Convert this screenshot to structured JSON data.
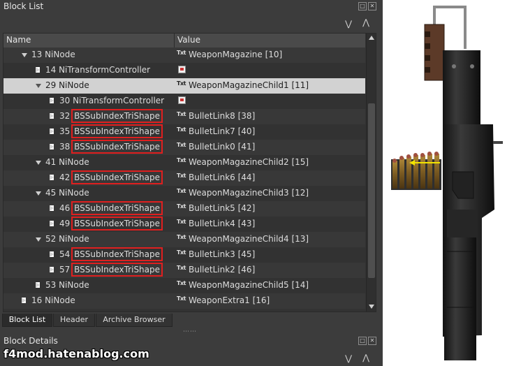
{
  "block_list": {
    "title": "Block List",
    "title_buttons": [
      "restore-icon",
      "close-icon"
    ],
    "columns": {
      "name": "Name",
      "value": "Value"
    },
    "rows": [
      {
        "indent": 1,
        "expander": "down",
        "name": "13 NiNode",
        "value_icon": "Txt",
        "value": "WeaponMagazine [10]",
        "highlight": false,
        "selected": false
      },
      {
        "indent": 2,
        "expander": "right",
        "name": "14 NiTransformController",
        "value_icon": "flag",
        "value": "",
        "highlight": false,
        "selected": false
      },
      {
        "indent": 2,
        "expander": "down",
        "name": "29 NiNode",
        "value_icon": "Txt",
        "value": "WeaponMagazineChild1 [11]",
        "highlight": false,
        "selected": true
      },
      {
        "indent": 3,
        "expander": "right",
        "name": "30 NiTransformController",
        "value_icon": "flag",
        "value": "",
        "highlight": false,
        "selected": false
      },
      {
        "indent": 3,
        "expander": "right",
        "idx": "32",
        "label": "BSSubIndexTriShape",
        "value_icon": "Txt",
        "value": "BulletLink8 [38]",
        "highlight": true,
        "selected": false
      },
      {
        "indent": 3,
        "expander": "right",
        "idx": "35",
        "label": "BSSubIndexTriShape",
        "value_icon": "Txt",
        "value": "BulletLink7 [40]",
        "highlight": true,
        "selected": false
      },
      {
        "indent": 3,
        "expander": "right",
        "idx": "38",
        "label": "BSSubIndexTriShape",
        "value_icon": "Txt",
        "value": "BulletLink0 [41]",
        "highlight": true,
        "selected": false
      },
      {
        "indent": 2,
        "expander": "down",
        "name": "41 NiNode",
        "value_icon": "Txt",
        "value": "WeaponMagazineChild2 [15]",
        "highlight": false,
        "selected": false
      },
      {
        "indent": 3,
        "expander": "right",
        "idx": "42",
        "label": "BSSubIndexTriShape",
        "value_icon": "Txt",
        "value": "BulletLink6 [44]",
        "highlight": true,
        "selected": false
      },
      {
        "indent": 2,
        "expander": "down",
        "name": "45 NiNode",
        "value_icon": "Txt",
        "value": "WeaponMagazineChild3 [12]",
        "highlight": false,
        "selected": false
      },
      {
        "indent": 3,
        "expander": "right",
        "idx": "46",
        "label": "BSSubIndexTriShape",
        "value_icon": "Txt",
        "value": "BulletLink5 [42]",
        "highlight": true,
        "selected": false
      },
      {
        "indent": 3,
        "expander": "right",
        "idx": "49",
        "label": "BSSubIndexTriShape",
        "value_icon": "Txt",
        "value": "BulletLink4 [43]",
        "highlight": true,
        "selected": false
      },
      {
        "indent": 2,
        "expander": "down",
        "name": "52 NiNode",
        "value_icon": "Txt",
        "value": "WeaponMagazineChild4 [13]",
        "highlight": false,
        "selected": false
      },
      {
        "indent": 3,
        "expander": "right",
        "idx": "54",
        "label": "BSSubIndexTriShape",
        "value_icon": "Txt",
        "value": "BulletLink3 [45]",
        "highlight": true,
        "selected": false
      },
      {
        "indent": 3,
        "expander": "right",
        "idx": "57",
        "label": "BSSubIndexTriShape",
        "value_icon": "Txt",
        "value": "BulletLink2 [46]",
        "highlight": true,
        "selected": false
      },
      {
        "indent": 2,
        "expander": "right",
        "name": "53 NiNode",
        "value_icon": "Txt",
        "value": "WeaponMagazineChild5 [14]",
        "highlight": false,
        "selected": false
      },
      {
        "indent": 1,
        "expander": "right",
        "name": "16 NiNode",
        "value_icon": "Txt",
        "value": "WeaponExtra1 [16]",
        "highlight": false,
        "selected": false
      }
    ]
  },
  "tabs": [
    {
      "label": "Block List",
      "active": true
    },
    {
      "label": "Header",
      "active": false
    },
    {
      "label": "Archive Browser",
      "active": false
    }
  ],
  "block_details": {
    "title": "Block Details"
  },
  "watermark": "f4mod.hatenablog.com",
  "viewport": {
    "object": "weapon-magazine-render"
  },
  "colors": {
    "highlight_box": "#e01f1f",
    "selected_row": "#d2d2d2",
    "panel_bg": "#3c3c3c"
  }
}
